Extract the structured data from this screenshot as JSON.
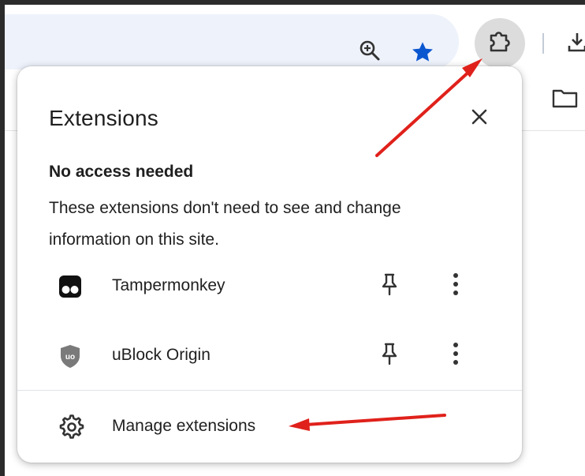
{
  "popup": {
    "title": "Extensions",
    "section_title": "No access needed",
    "section_description": "These extensions don't need to see and change information on this site.",
    "extensions": [
      {
        "name": "Tampermonkey",
        "icon": "tampermonkey-icon"
      },
      {
        "name": "uBlock Origin",
        "icon": "ublock-origin-icon"
      }
    ],
    "manage_label": "Manage extensions"
  },
  "toolbar": {
    "icons": [
      "zoom-icon",
      "bookmark-star-icon",
      "extensions-puzzle-icon",
      "download-icon",
      "folder-icon"
    ]
  },
  "colors": {
    "accent_blue": "#0b57d0",
    "annotation_red": "#e0211b",
    "omnibox_bg": "#eef2fb",
    "text": "#1f1f1f"
  }
}
